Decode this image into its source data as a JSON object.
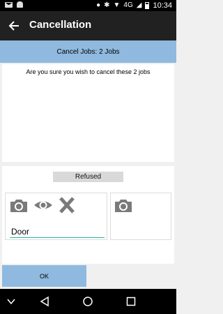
{
  "status_bar": {
    "network": "4G",
    "time": "10:34"
  },
  "app_bar": {
    "title": "Cancellation"
  },
  "banner": {
    "text": "Cancel Jobs: 2 Jobs"
  },
  "message": {
    "text": "Are you sure you wish to cancel these 2 jobs"
  },
  "reason": {
    "label": "Refused",
    "input_value": "Door"
  },
  "ok_button": {
    "label": "OK"
  },
  "colors": {
    "accent": "#8fb9df",
    "appbar": "#212121",
    "input_underline": "#2bb3a2",
    "icon_gray": "#7a7a7a"
  },
  "icons": [
    "back-arrow-icon",
    "camera-icon",
    "eye-icon",
    "close-icon",
    "nav-back-icon",
    "nav-home-icon",
    "nav-recents-icon"
  ]
}
